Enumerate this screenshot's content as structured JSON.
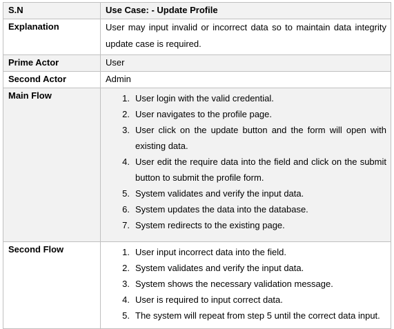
{
  "table": {
    "header": {
      "label": "S.N",
      "value": "Use Case: - Update Profile"
    },
    "explanation": {
      "label": "Explanation",
      "line1": "User may input invalid or incorrect data so to maintain data integrity",
      "line2": "update case is required."
    },
    "prime_actor": {
      "label": "Prime Actor",
      "value": "User"
    },
    "second_actor": {
      "label": "Second Actor",
      "value": "Admin"
    },
    "main_flow": {
      "label": "Main Flow",
      "steps": [
        {
          "num": "1.",
          "lines": [
            "User login with the valid credential."
          ]
        },
        {
          "num": "2.",
          "lines": [
            "User navigates to the profile page."
          ]
        },
        {
          "num": "3.",
          "lines": [
            "User click on the update button and the form will open with",
            "existing data."
          ]
        },
        {
          "num": "4.",
          "lines": [
            "User edit the require data into the field and click on the submit",
            "button to submit the profile form."
          ]
        },
        {
          "num": "5.",
          "lines": [
            "System validates and verify the input data."
          ]
        },
        {
          "num": "6.",
          "lines": [
            "System updates the data into the database."
          ]
        },
        {
          "num": "7.",
          "lines": [
            "System redirects to the existing page."
          ]
        }
      ]
    },
    "second_flow": {
      "label": "Second Flow",
      "steps": [
        {
          "num": "1.",
          "lines": [
            "User input incorrect data into the field."
          ]
        },
        {
          "num": "2.",
          "lines": [
            "System validates and verify the input data."
          ]
        },
        {
          "num": "3.",
          "lines": [
            "System shows the necessary validation message."
          ]
        },
        {
          "num": "4.",
          "lines": [
            "User is required to input correct data."
          ]
        },
        {
          "num": "5.",
          "lines": [
            "The system will repeat from step 5 until the correct data input."
          ]
        }
      ]
    }
  }
}
